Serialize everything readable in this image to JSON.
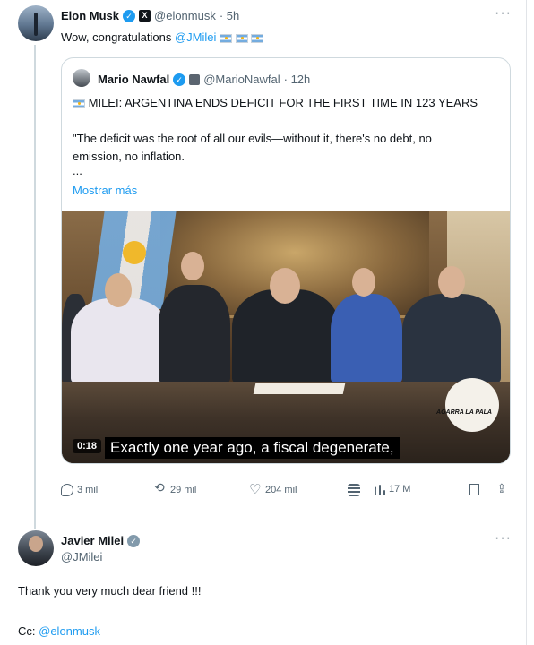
{
  "colors": {
    "link": "#1d9bf0",
    "verified": "#1d9bf0",
    "muted": "#536471",
    "text": "#0f1419"
  },
  "main_post": {
    "author_name": "Elon Musk",
    "author_handle": "@elonmusk",
    "time": "· 5h",
    "text_prefix": "Wow, congratulations ",
    "mention": "@JMilei",
    "more_icon": "more-horizontal-icon"
  },
  "quoted_post": {
    "author_name": "Mario Nawfal",
    "author_handle": "@MarioNawfal",
    "time": "· 12h",
    "headline": "MILEI: ARGENTINA ENDS DEFICIT FOR THE FIRST TIME IN 123 YEARS",
    "quote_line1": "\"The deficit was the root of all our evils—without it, there's no debt, no",
    "quote_line2": "emission, no inflation.",
    "ellipsis": "...",
    "show_more": "Mostrar más",
    "video": {
      "timestamp": "0:18",
      "subtitle": "Exactly one year ago, a fiscal degenerate,",
      "logo_text": "AGARRA LA PALA"
    }
  },
  "actions": {
    "replies": "3 mil",
    "reposts": "29 mil",
    "likes": "204 mil",
    "views": "17 M"
  },
  "reply_post": {
    "author_name": "Javier Milei",
    "author_handle": "@JMilei",
    "text": "Thank you very much dear friend !!!",
    "cc_label": "Cc: ",
    "cc_mention": "@elonmusk"
  }
}
